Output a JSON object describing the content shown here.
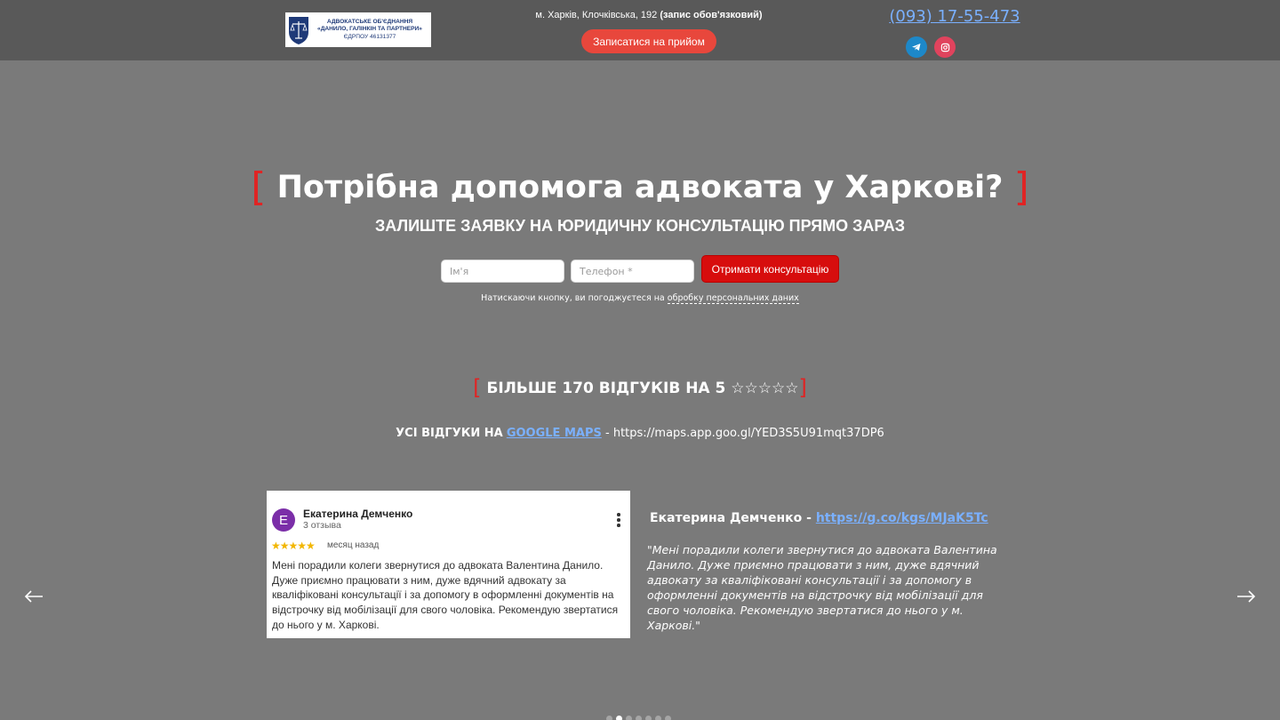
{
  "header": {
    "logo": {
      "line1": "АДВОКАТСЬКЕ ОБ'ЄДНАННЯ",
      "line2": "«ДАНИЛО, ГАЛІНКІН ТА ПАРТНЕРИ»",
      "line3": "ЄДРПОУ 46131377"
    },
    "address": "м. Харків, Клочківська, 192",
    "address_note": "(запис обов'язковий)",
    "appointment_button": "Записатися на прийом",
    "phone": "(093) 17-55-473",
    "social": [
      "telegram-icon",
      "instagram-icon"
    ],
    "colors": {
      "header_bg": "#595959",
      "accent": "#e8473c",
      "link": "#7ab0ff"
    }
  },
  "hero": {
    "bracket_open": "[",
    "title": "Потрібна допомога адвоката у Харкові?",
    "bracket_close": "]",
    "subtitle": "ЗАЛИШТЕ ЗАЯВКУ НА ЮРИДИЧНУ КОНСУЛЬТАЦІЮ ПРЯМО ЗАРАЗ",
    "name_placeholder": "Ім'я",
    "phone_placeholder": "Телефон *",
    "submit_button": "Отримати консультацію",
    "consent_text": "Натискаючи кнопку, ви погоджуєтеся на",
    "consent_link": "обробку персональних даних"
  },
  "reviews": {
    "bracket_open": "[",
    "title": "БІЛЬШЕ 170 ВІДГУКІВ НА 5 ☆☆☆☆☆",
    "bracket_close": "]",
    "all_label": "УСІ ВІДГУКИ НА",
    "maps_link": "GOOGLE MAPS",
    "maps_separator": " - ",
    "maps_url": "https://maps.app.goo.gl/YED3S5U91mqt37DP6",
    "card": {
      "avatar_letter": "E",
      "name": "Екатерина Демченко",
      "count": "3 отзыва",
      "stars": "★★★★★",
      "when": "месяц назад",
      "text": "Мені порадили колеги звернутися до адвоката Валентина Данило. Дуже приємно працювати з ним, дуже вдячний адвокату за кваліфіковані консультації і за допомогу в оформленні документів на відстрочку від мобілізації для свого чоловіка. Рекомендую звертатися до нього у м. Харкові."
    },
    "quote_author": "Екатерина Демченко -",
    "quote_link": "https://g.co/kgs/MJaK5Tc",
    "quote_text": "\"Мені порадили колеги звернутися до адвоката Валентина Данило. Дуже приємно працювати з ним, дуже вдячний адвокату за кваліфіковані консультації і за допомогу в оформленні документів на відстрочку від мобілізації для свого чоловіка. Рекомендую звертатися до нього у м. Харкові.\"",
    "slides_total": 7,
    "active_slide": 2
  },
  "colors": {
    "page_bg": "#7a7a7a",
    "bracket": "#e02424",
    "submit_bg": "#d70d0d"
  }
}
